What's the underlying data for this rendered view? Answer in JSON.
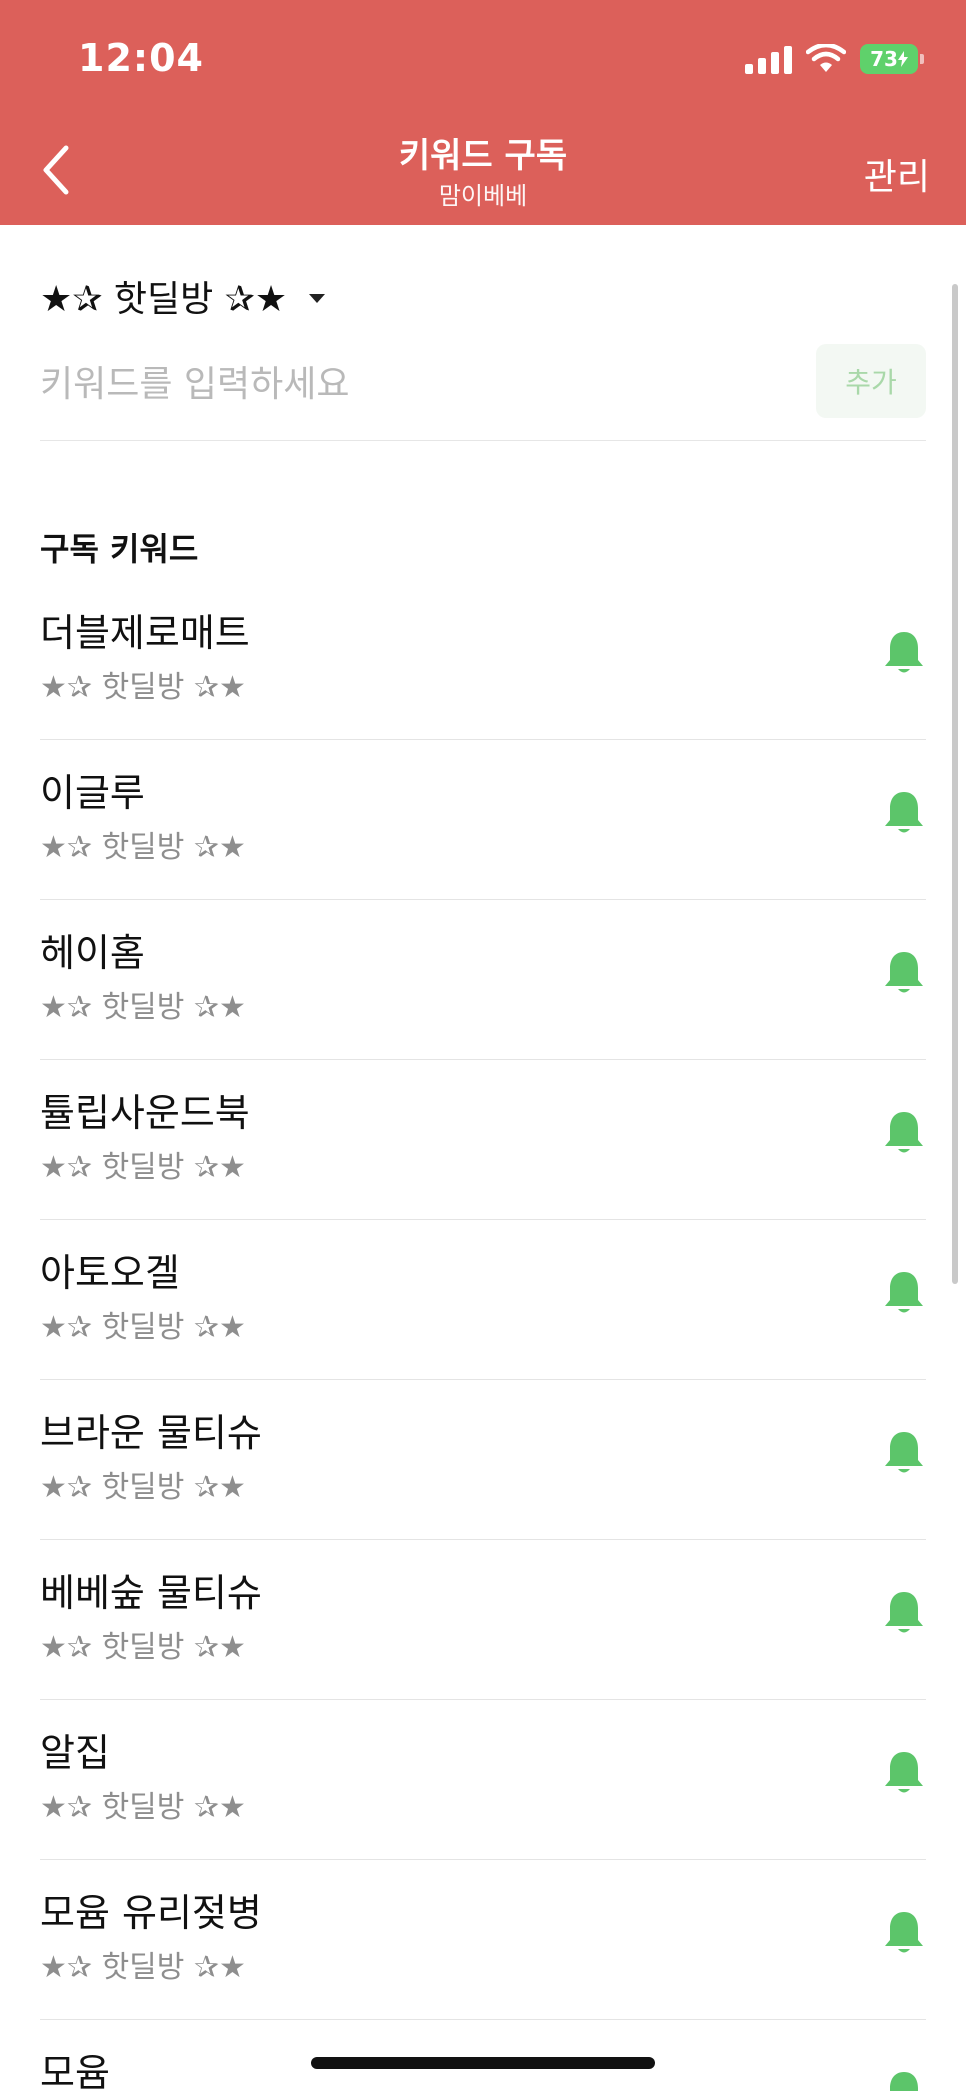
{
  "status_bar": {
    "time": "12:04",
    "battery": "73"
  },
  "header": {
    "title": "키워드 구독",
    "subtitle": "맘이베베",
    "manage_label": "관리"
  },
  "room_selector": {
    "label": "★✰ 핫딜방 ✰★"
  },
  "keyword_input": {
    "placeholder": "키워드를 입력하세요",
    "value": "",
    "add_label": "추가"
  },
  "section": {
    "label": "구독 키워드"
  },
  "keywords": [
    {
      "name": "더블제로매트",
      "room": "★✰ 핫딜방 ✰★"
    },
    {
      "name": "이글루",
      "room": "★✰ 핫딜방 ✰★"
    },
    {
      "name": "헤이홈",
      "room": "★✰ 핫딜방 ✰★"
    },
    {
      "name": "튤립사운드북",
      "room": "★✰ 핫딜방 ✰★"
    },
    {
      "name": "아토오겔",
      "room": "★✰ 핫딜방 ✰★"
    },
    {
      "name": "브라운 물티슈",
      "room": "★✰ 핫딜방 ✰★"
    },
    {
      "name": "베베숲 물티슈",
      "room": "★✰ 핫딜방 ✰★"
    },
    {
      "name": "알집",
      "room": "★✰ 핫딜방 ✰★"
    },
    {
      "name": "모윰 유리젖병",
      "room": "★✰ 핫딜방 ✰★"
    },
    {
      "name": "모윰",
      "room": ""
    }
  ],
  "icons": {
    "back": "chevron-left-icon",
    "bell": "bell-icon",
    "dropdown": "caret-down-icon"
  },
  "colors": {
    "header_bg": "#dc605a",
    "bell": "#5cc56a",
    "battery": "#5fd16b"
  }
}
